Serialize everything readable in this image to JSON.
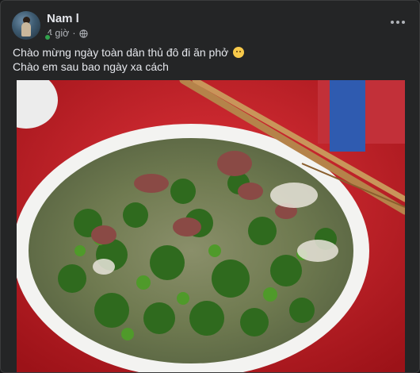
{
  "post": {
    "author": "Nam l",
    "time": "4 giờ",
    "separator": "·",
    "privacy_icon": "globe-icon",
    "menu_icon": "more-options-icon",
    "text_line1": "Chào mừng ngày toàn dân thủ đô đi ăn phở",
    "emoji_icon": "smiling-face-emoji",
    "text_line2": "Chào em sau bao ngày xa cách",
    "photo_subject": "pho-bowl-photo"
  },
  "colors": {
    "card_bg": "#242526",
    "text_primary": "#e4e6eb",
    "text_secondary": "#b0b3b8",
    "online": "#31a24c",
    "table_red": "#d9212a"
  }
}
